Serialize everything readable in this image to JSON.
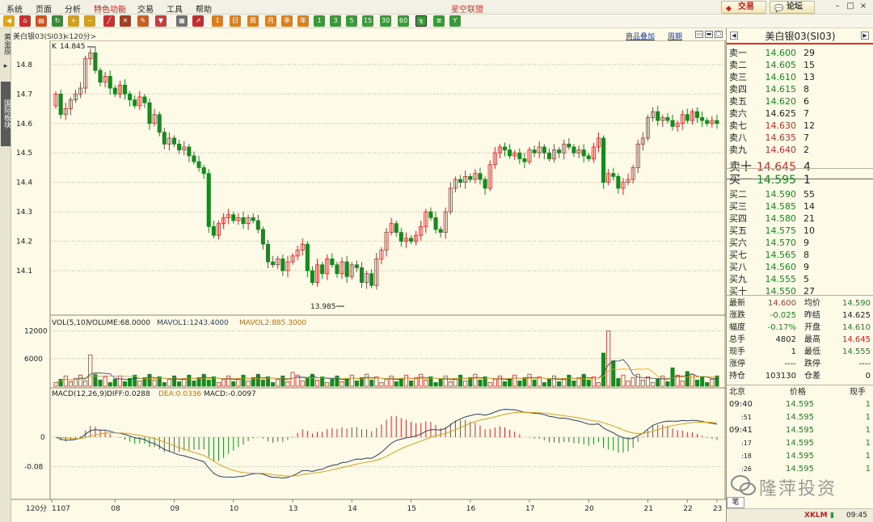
{
  "menu": {
    "items": [
      "系统",
      "页面",
      "分析",
      "特色功能",
      "交易",
      "工具",
      "帮助"
    ],
    "app_title": "星空联盟",
    "trade_button": "交易",
    "forum_button": "论坛"
  },
  "left_tabs": {
    "tab1": "黄金原",
    "tab2": "国际板块"
  },
  "chart_header": {
    "symbol": "美白银03(SI03)",
    "period": "<120分>",
    "overlay_link": "商品叠加",
    "cycle_link": "周期"
  },
  "main_chart": {
    "corner_label": "K",
    "high_label": "14.845",
    "low_label": "13.985",
    "y_ticks": [
      "14.8",
      "14.7",
      "14.6",
      "14.5",
      "14.4",
      "14.3",
      "14.2",
      "14.1"
    ]
  },
  "volume_panel": {
    "legend_vol": "VOL(5,10)",
    "legend_volume": "VOLUME:68.0000",
    "legend_mavol1": "MAVOL1:1243.4000",
    "legend_mavol2": "MAVOL2:885.3000",
    "y_ticks": [
      "12000",
      "6000"
    ]
  },
  "macd_panel": {
    "legend_macd": "MACD(12,26,9)",
    "legend_diff": "DIFF:0.0288",
    "legend_dea": "DEA:0.0336",
    "legend_val": "MACD:-0.0097",
    "y_ticks": [
      "0",
      "-0.08"
    ]
  },
  "x_axis": {
    "period_label": "120分",
    "labels": [
      "1107",
      "08",
      "09",
      "10",
      "13",
      "14",
      "15",
      "16",
      "17",
      "20",
      "21",
      "22",
      "23"
    ]
  },
  "quote": {
    "title": "美白银03(SI03)",
    "asks": [
      {
        "label": "卖十",
        "price": "14.645",
        "vol": "4"
      },
      {
        "label": "卖九",
        "price": "14.640",
        "vol": "2"
      },
      {
        "label": "卖八",
        "price": "14.635",
        "vol": "7"
      },
      {
        "label": "卖七",
        "price": "14.630",
        "vol": "12"
      },
      {
        "label": "卖六",
        "price": "14.625",
        "vol": "7"
      },
      {
        "label": "卖五",
        "price": "14.620",
        "vol": "6"
      },
      {
        "label": "卖四",
        "price": "14.615",
        "vol": "8"
      },
      {
        "label": "卖三",
        "price": "14.610",
        "vol": "13"
      },
      {
        "label": "卖二",
        "price": "14.605",
        "vol": "15"
      },
      {
        "label": "卖一",
        "price": "14.600",
        "vol": "29"
      }
    ],
    "bids": [
      {
        "label": "买一",
        "price": "14.595",
        "vol": "1"
      },
      {
        "label": "买二",
        "price": "14.590",
        "vol": "55"
      },
      {
        "label": "买三",
        "price": "14.585",
        "vol": "14"
      },
      {
        "label": "买四",
        "price": "14.580",
        "vol": "21"
      },
      {
        "label": "买五",
        "price": "14.575",
        "vol": "10"
      },
      {
        "label": "买六",
        "price": "14.570",
        "vol": "9"
      },
      {
        "label": "买七",
        "price": "14.565",
        "vol": "8"
      },
      {
        "label": "买八",
        "price": "14.560",
        "vol": "9"
      },
      {
        "label": "买九",
        "price": "14.555",
        "vol": "5"
      },
      {
        "label": "买十",
        "price": "14.550",
        "vol": "27"
      }
    ],
    "stats": [
      {
        "l1": "最新",
        "v1": "14.600",
        "l2": "均价",
        "v2": "14.590"
      },
      {
        "l1": "涨跌",
        "v1": "-0.025",
        "l2": "昨结",
        "v2": "14.625"
      },
      {
        "l1": "幅度",
        "v1": "-0.17%",
        "l2": "开盘",
        "v2": "14.610"
      },
      {
        "l1": "总手",
        "v1": "4802",
        "l2": "最高",
        "v2": "14.645"
      },
      {
        "l1": "现手",
        "v1": "1",
        "l2": "最低",
        "v2": "14.555"
      },
      {
        "l1": "涨停",
        "v1": "----",
        "l2": "跌停",
        "v2": "----"
      },
      {
        "l1": "持仓",
        "v1": "103130",
        "l2": "仓差",
        "v2": "0"
      }
    ],
    "trades_header": {
      "city": "北京",
      "price": "价格",
      "vol": "现手"
    },
    "trades": [
      {
        "time": "09:40",
        "price": "14.595",
        "vol": "1"
      },
      {
        "time": ":51",
        "price": "14.595",
        "vol": "1"
      },
      {
        "time": "09:41",
        "price": "14.595",
        "vol": "1"
      },
      {
        "time": ":17",
        "price": "14.595",
        "vol": "1"
      },
      {
        "time": ":18",
        "price": "14.595",
        "vol": "1"
      },
      {
        "time": ":26",
        "price": "14.595",
        "vol": "1"
      }
    ],
    "bottom_tab": "笔",
    "watermark": "隆萍投资",
    "status_brand": "XKLM",
    "status_time": "09:45"
  },
  "colors": {
    "up": "#d02828",
    "down": "#16891f",
    "ma_gold": "#d8a020",
    "ma_blue": "#2a4060"
  }
}
